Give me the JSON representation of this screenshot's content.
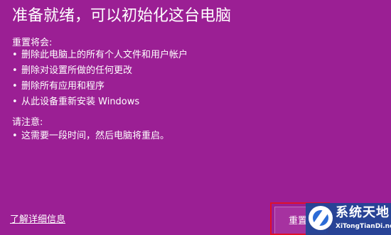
{
  "dialog": {
    "title": "准备就绪，可以初始化这台电脑",
    "reset_will_label": "重置将会:",
    "reset_will_items": [
      "删除此电脑上的所有个人文件和用户帐户",
      "删除对设置所做的任何更改",
      "删除所有应用和程序",
      "从此设备重新安装 Windows"
    ],
    "note_label": "请注意:",
    "note_items": [
      "这需要一段时间，然后电脑将重启。"
    ],
    "bullet_char": "•",
    "learn_more_link": "了解详细信息",
    "reset_button_label": "重置"
  },
  "watermark": {
    "title": "系统天地",
    "url": "XiTongTianDi.net",
    "icon": "logo-icon"
  },
  "colors": {
    "background": "#9b1f94",
    "text": "#ffffff",
    "highlight_border": "#e0102a",
    "watermark_bg": "#1e4696"
  }
}
